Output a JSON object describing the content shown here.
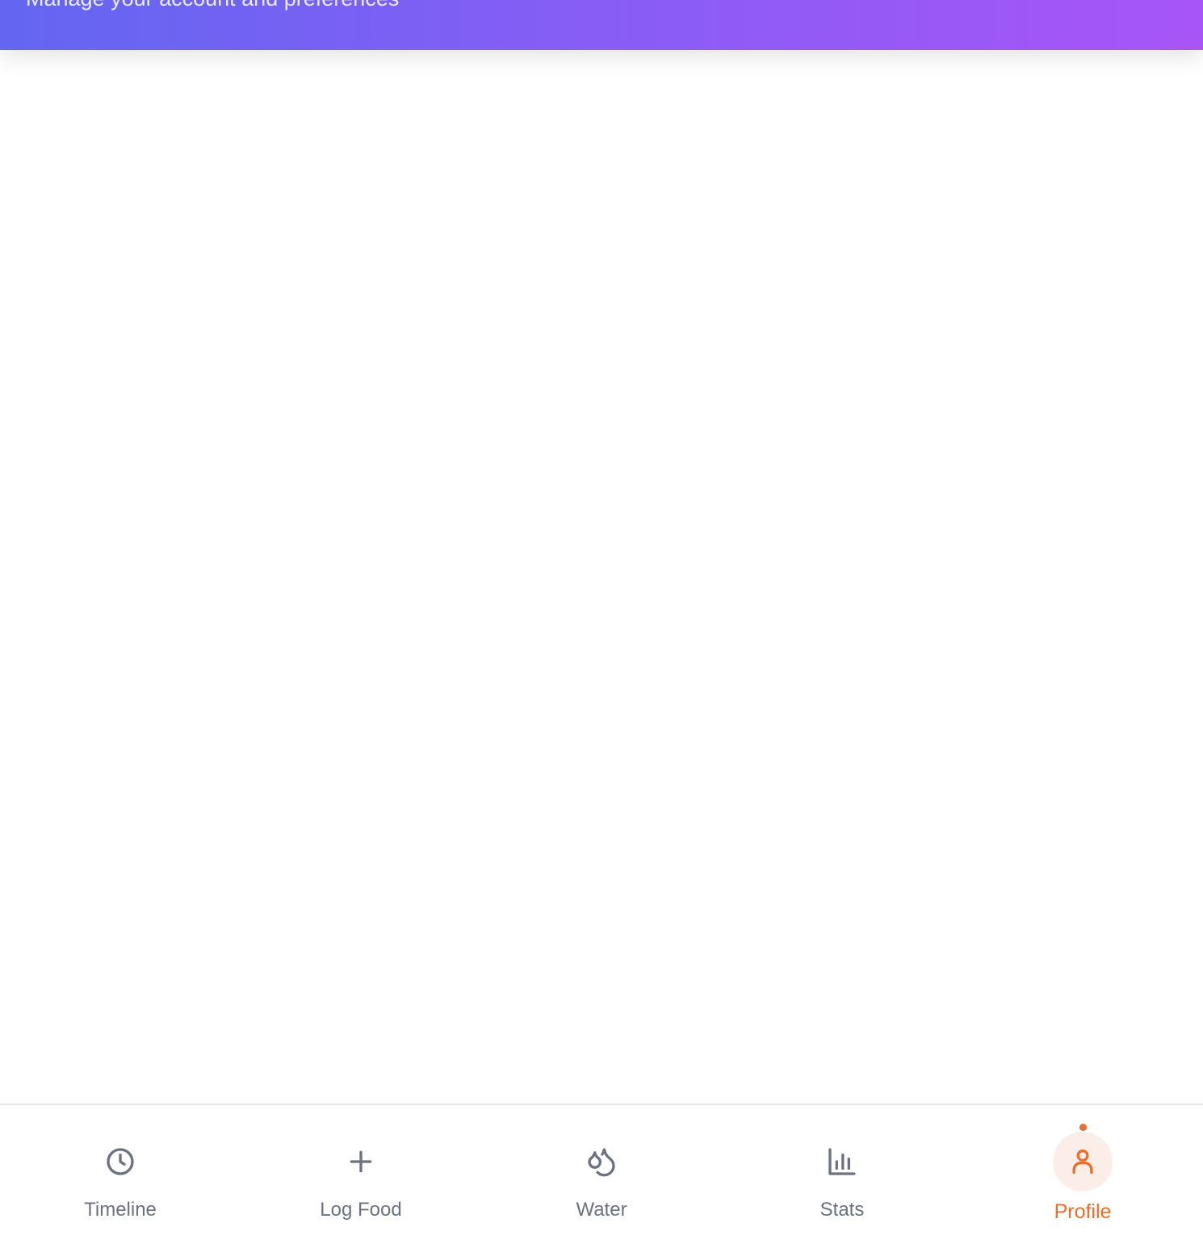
{
  "header": {
    "subtitle": "Manage your account and preferences"
  },
  "bottom_nav": {
    "active": "Profile",
    "items": [
      {
        "label": "Timeline",
        "icon": "clock-icon"
      },
      {
        "label": "Log Food",
        "icon": "plus-icon"
      },
      {
        "label": "Water",
        "icon": "droplets-icon"
      },
      {
        "label": "Stats",
        "icon": "bar-chart-icon"
      },
      {
        "label": "Profile",
        "icon": "user-icon"
      }
    ]
  },
  "colors": {
    "header_gradient_start": "#6366f1",
    "header_gradient_end": "#a855f7",
    "active_accent": "#ea6f2d",
    "inactive_nav": "#6b7280"
  }
}
